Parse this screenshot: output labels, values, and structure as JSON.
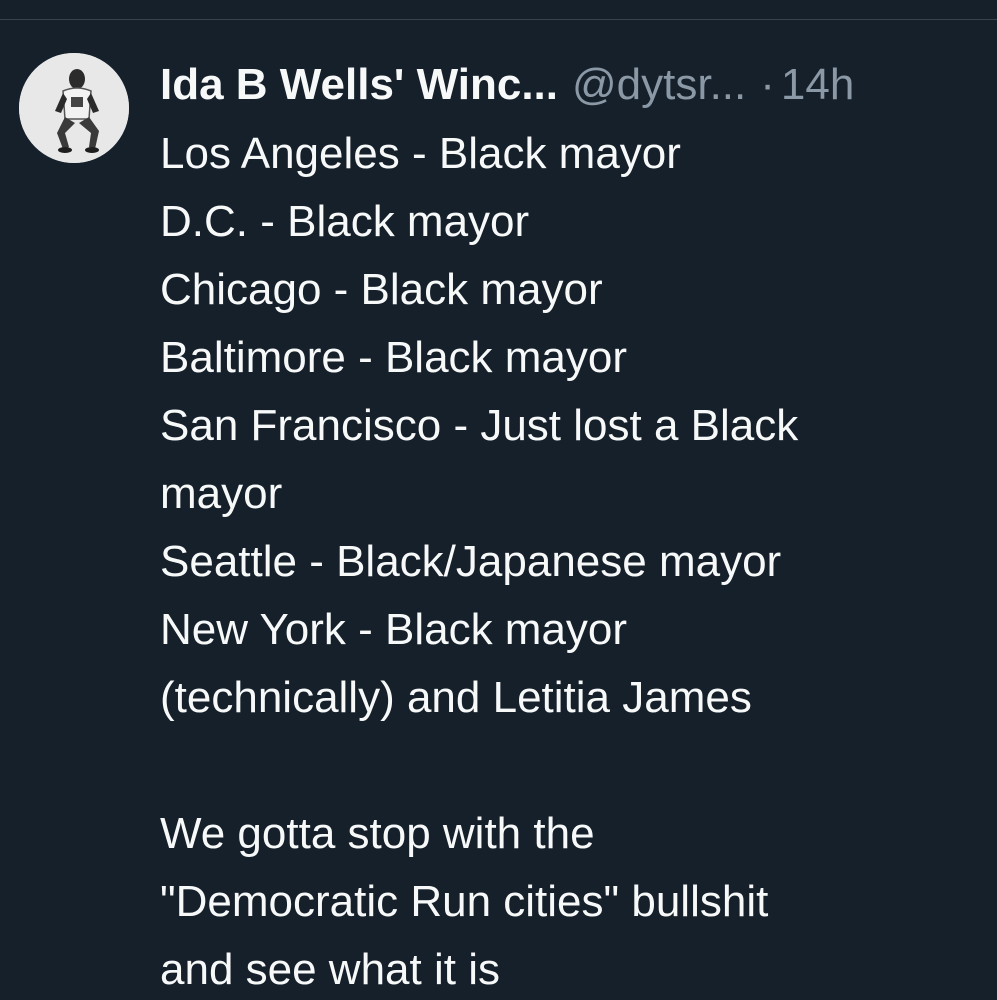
{
  "tweet": {
    "author": {
      "display_name": "Ida B Wells' Winc...",
      "handle": "@dytsr...",
      "separator": "·",
      "time": "14h"
    },
    "lines": [
      "Los Angeles - Black mayor",
      "D.C. - Black mayor",
      "Chicago - Black mayor",
      "Baltimore - Black mayor",
      "San Francisco - Just lost a Black",
      "mayor",
      "Seattle - Black/Japanese mayor",
      "New York - Black mayor",
      "(technically) and Letitia James"
    ],
    "closing_lines": [
      "We gotta stop with the",
      "\"Democratic Run cities\" bullshit",
      "and see what it is"
    ]
  },
  "colors": {
    "background": "#15202b",
    "text_primary": "#f7f9f9",
    "text_secondary": "#8b98a5",
    "divider": "#38444d"
  }
}
